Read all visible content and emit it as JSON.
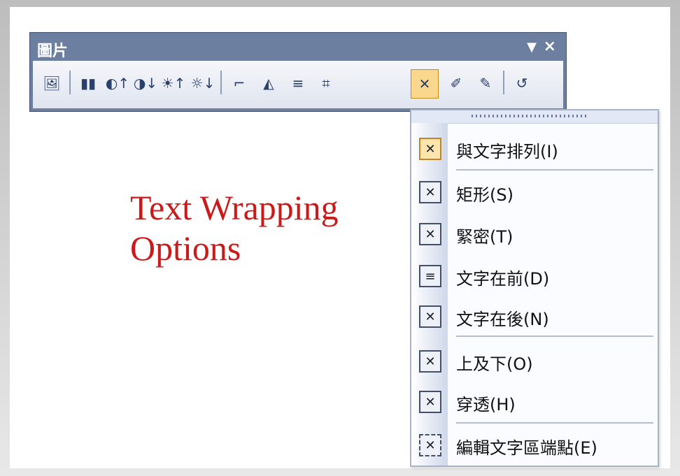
{
  "toolbar": {
    "title": "圖片",
    "dropdown_glyph": "▼",
    "close_glyph": "×",
    "buttons": [
      {
        "name": "insert-picture",
        "glyph": "🖼"
      },
      {
        "name": "color",
        "glyph": "▮▮"
      },
      {
        "name": "more-contrast",
        "glyph": "◐↑"
      },
      {
        "name": "less-contrast",
        "glyph": "◑↓"
      },
      {
        "name": "more-brightness",
        "glyph": "☀↑"
      },
      {
        "name": "less-brightness",
        "glyph": "☼↓"
      },
      {
        "name": "crop",
        "glyph": "⌐"
      },
      {
        "name": "rotate-left",
        "glyph": "◭"
      },
      {
        "name": "line-style",
        "glyph": "≡"
      },
      {
        "name": "compress-pictures",
        "glyph": "⌗"
      },
      {
        "name": "text-wrapping",
        "glyph": "✕"
      },
      {
        "name": "format-picture",
        "glyph": "✐"
      },
      {
        "name": "set-transparent-color",
        "glyph": "✎"
      },
      {
        "name": "reset-picture",
        "glyph": "↺"
      }
    ]
  },
  "menu": {
    "items": [
      {
        "label": "與文字排列(I)",
        "glyph": "✕"
      },
      {
        "label": "矩形(S)",
        "glyph": "✕"
      },
      {
        "label": "緊密(T)",
        "glyph": "✕"
      },
      {
        "label": "文字在前(D)",
        "glyph": "≡"
      },
      {
        "label": "文字在後(N)",
        "glyph": "✕"
      },
      {
        "label": "上及下(O)",
        "glyph": "✕"
      },
      {
        "label": "穿透(H)",
        "glyph": "✕"
      },
      {
        "label": "編輯文字區端點(E)",
        "glyph": "✕"
      }
    ]
  },
  "slide": {
    "headline_line1": "Text Wrapping",
    "headline_line2": "Options"
  },
  "colors": {
    "headline": "#cc1a1a",
    "toolbar_title_bar": "#6c7fa0",
    "active_highlight": "#f9d78c"
  }
}
